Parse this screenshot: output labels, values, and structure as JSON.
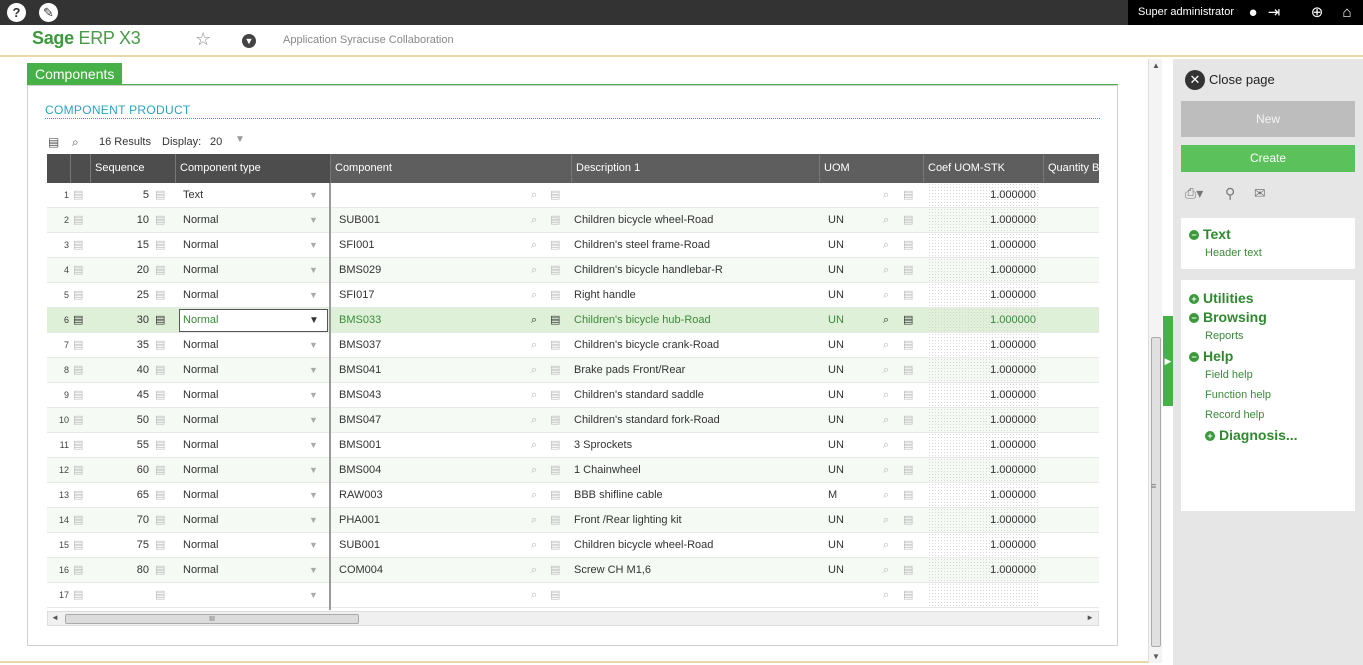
{
  "topbar": {
    "user_name": "Super administrator",
    "help_icon": "help-icon",
    "tools_icon": "tools-icon"
  },
  "header": {
    "logo_sage": "Sage",
    "logo_erp": "ERP X3",
    "app_name": "Application Syracuse Collaboration"
  },
  "tab": {
    "label": "Components"
  },
  "section": {
    "title": "COMPONENT PRODUCT"
  },
  "toolbar": {
    "results": "16 Results",
    "display_label": "Display:",
    "display_value": "20"
  },
  "grid": {
    "headers": {
      "sequence": "Sequence",
      "component_type": "Component type",
      "component": "Component",
      "description": "Description 1",
      "uom": "UOM",
      "coef": "Coef UOM-STK",
      "quantity": "Quantity Ba"
    },
    "rows": [
      {
        "n": "1",
        "seq": "5",
        "type": "Text",
        "comp": "",
        "desc": "",
        "uom": "",
        "coef": "1.000000"
      },
      {
        "n": "2",
        "seq": "10",
        "type": "Normal",
        "comp": "SUB001",
        "desc": "Children bicycle wheel-Road",
        "uom": "UN",
        "coef": "1.000000"
      },
      {
        "n": "3",
        "seq": "15",
        "type": "Normal",
        "comp": "SFI001",
        "desc": "Children's steel frame-Road",
        "uom": "UN",
        "coef": "1.000000"
      },
      {
        "n": "4",
        "seq": "20",
        "type": "Normal",
        "comp": "BMS029",
        "desc": "Children's bicycle handlebar-R",
        "uom": "UN",
        "coef": "1.000000"
      },
      {
        "n": "5",
        "seq": "25",
        "type": "Normal",
        "comp": "SFI017",
        "desc": "Right handle",
        "uom": "UN",
        "coef": "1.000000"
      },
      {
        "n": "6",
        "seq": "30",
        "type": "Normal",
        "comp": "BMS033",
        "desc": "Children's bicycle hub-Road",
        "uom": "UN",
        "coef": "1.000000"
      },
      {
        "n": "7",
        "seq": "35",
        "type": "Normal",
        "comp": "BMS037",
        "desc": "Children's bicycle crank-Road",
        "uom": "UN",
        "coef": "1.000000"
      },
      {
        "n": "8",
        "seq": "40",
        "type": "Normal",
        "comp": "BMS041",
        "desc": "Brake pads Front/Rear",
        "uom": "UN",
        "coef": "1.000000"
      },
      {
        "n": "9",
        "seq": "45",
        "type": "Normal",
        "comp": "BMS043",
        "desc": "Children's standard saddle",
        "uom": "UN",
        "coef": "1.000000"
      },
      {
        "n": "10",
        "seq": "50",
        "type": "Normal",
        "comp": "BMS047",
        "desc": "Children's standard fork-Road",
        "uom": "UN",
        "coef": "1.000000"
      },
      {
        "n": "11",
        "seq": "55",
        "type": "Normal",
        "comp": "BMS001",
        "desc": "3 Sprockets",
        "uom": "UN",
        "coef": "1.000000"
      },
      {
        "n": "12",
        "seq": "60",
        "type": "Normal",
        "comp": "BMS004",
        "desc": "1 Chainwheel",
        "uom": "UN",
        "coef": "1.000000"
      },
      {
        "n": "13",
        "seq": "65",
        "type": "Normal",
        "comp": "RAW003",
        "desc": "BBB shifline cable",
        "uom": "M",
        "coef": "1.000000"
      },
      {
        "n": "14",
        "seq": "70",
        "type": "Normal",
        "comp": "PHA001",
        "desc": "Front /Rear lighting kit",
        "uom": "UN",
        "coef": "1.000000"
      },
      {
        "n": "15",
        "seq": "75",
        "type": "Normal",
        "comp": "SUB001",
        "desc": "Children bicycle wheel-Road",
        "uom": "UN",
        "coef": "1.000000"
      },
      {
        "n": "16",
        "seq": "80",
        "type": "Normal",
        "comp": "COM004",
        "desc": "Screw CH M1,6",
        "uom": "UN",
        "coef": "1.000000"
      },
      {
        "n": "17",
        "seq": "",
        "type": "",
        "comp": "",
        "desc": "",
        "uom": "",
        "coef": ""
      }
    ],
    "selected_row": 6,
    "scroll_grip": "III"
  },
  "right_panel": {
    "close_label": "Close page",
    "new_label": "New",
    "create_label": "Create",
    "text_section": "Text",
    "header_text": "Header text",
    "utilities": "Utilities",
    "browsing": "Browsing",
    "reports": "Reports",
    "help": "Help",
    "field_help": "Field help",
    "function_help": "Function help",
    "record_help": "Record help",
    "diagnosis": "Diagnosis..."
  },
  "colors": {
    "accent_green": "#46b146",
    "title_blue": "#2ba3c0",
    "topbar": "#333333"
  }
}
